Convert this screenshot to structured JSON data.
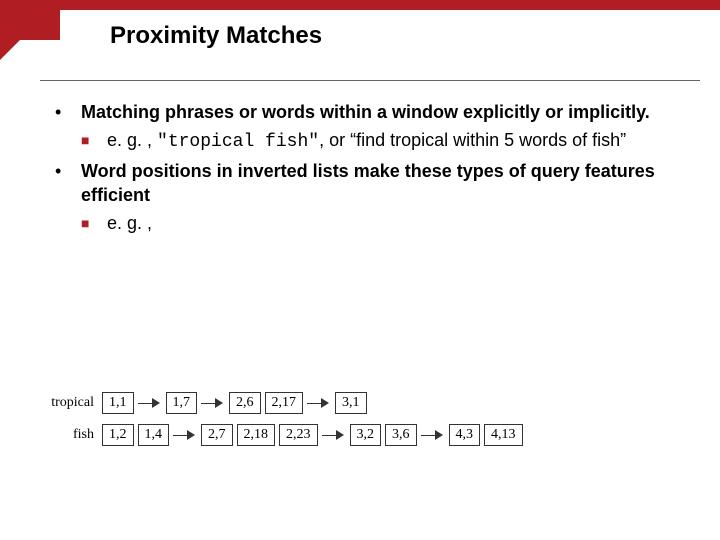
{
  "title": "Proximity Matches",
  "bullets": {
    "b1a": "Matching phrases or words within a window explicitly or implicitly.",
    "b1a_sub_prefix": "e. g. , ",
    "b1a_sub_code": "\"tropical fish\"",
    "b1a_sub_suffix": ", or “find tropical within 5 words of fish”",
    "b1b": "Word positions in inverted lists make these types of query features efficient",
    "b1b_sub": "e. g. ,"
  },
  "diagram": {
    "rows": [
      {
        "label": "tropical",
        "groups": [
          [
            "1,1"
          ],
          [
            "1,7"
          ],
          [
            "2,6",
            "2,17"
          ],
          [
            "3,1"
          ]
        ]
      },
      {
        "label": "fish",
        "groups": [
          [
            "1,2",
            "1,4"
          ],
          [
            "2,7",
            "2,18",
            "2,23"
          ],
          [
            "3,2",
            "3,6"
          ],
          [
            "4,3",
            "4,13"
          ]
        ]
      }
    ]
  }
}
